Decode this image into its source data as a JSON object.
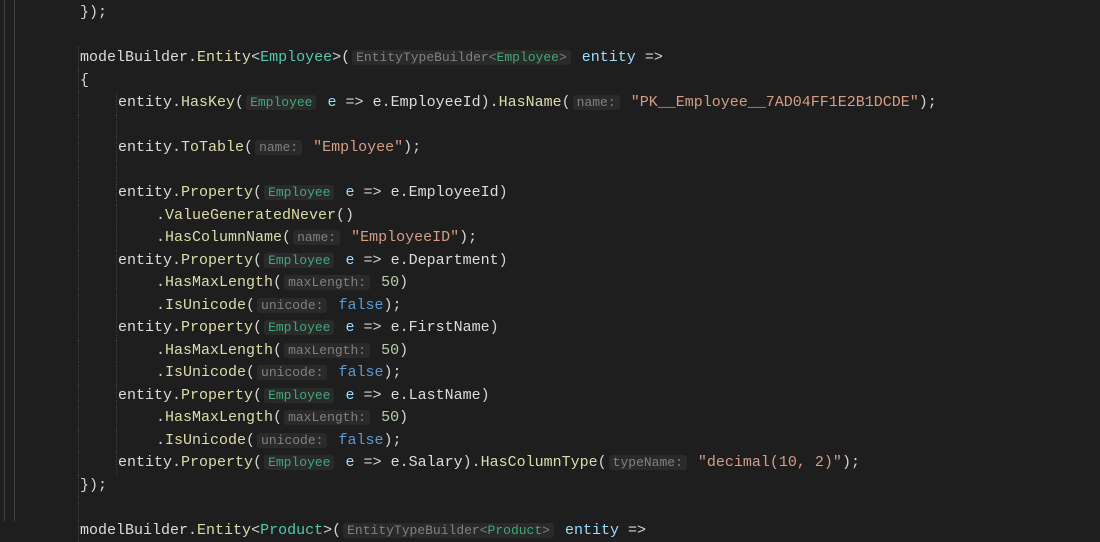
{
  "code": {
    "l0": "});",
    "l1a": "modelBuilder",
    "l1b": "Entity",
    "l1c": "Employee",
    "l1d": "EntityTypeBuilder",
    "l1e": "Employee",
    "l1f": "entity",
    "l2": "{",
    "l3a": "entity",
    "l3b": "HasKey",
    "l3c": "Employee",
    "l3d": "e",
    "l3e": "e",
    "l3f": "EmployeeId",
    "l3g": "HasName",
    "l3h": "name:",
    "l3i": "\"PK__Employee__7AD04FF1E2B1DCDE\"",
    "l5a": "entity",
    "l5b": "ToTable",
    "l5c": "name:",
    "l5d": "\"Employee\"",
    "l7a": "entity",
    "l7b": "Property",
    "l7c": "Employee",
    "l7d": "e",
    "l7e": "e",
    "l7f": "EmployeeId",
    "l8a": "ValueGeneratedNever",
    "l9a": "HasColumnName",
    "l9b": "name:",
    "l9c": "\"EmployeeID\"",
    "l10a": "entity",
    "l10b": "Property",
    "l10c": "Employee",
    "l10d": "e",
    "l10e": "e",
    "l10f": "Department",
    "l11a": "HasMaxLength",
    "l11b": "maxLength:",
    "l11c": "50",
    "l12a": "IsUnicode",
    "l12b": "unicode:",
    "l12c": "false",
    "l13a": "entity",
    "l13b": "Property",
    "l13c": "Employee",
    "l13d": "e",
    "l13e": "e",
    "l13f": "FirstName",
    "l14a": "HasMaxLength",
    "l14b": "maxLength:",
    "l14c": "50",
    "l15a": "IsUnicode",
    "l15b": "unicode:",
    "l15c": "false",
    "l16a": "entity",
    "l16b": "Property",
    "l16c": "Employee",
    "l16d": "e",
    "l16e": "e",
    "l16f": "LastName",
    "l17a": "HasMaxLength",
    "l17b": "maxLength:",
    "l17c": "50",
    "l18a": "IsUnicode",
    "l18b": "unicode:",
    "l18c": "false",
    "l19a": "entity",
    "l19b": "Property",
    "l19c": "Employee",
    "l19d": "e",
    "l19e": "e",
    "l19f": "Salary",
    "l19g": "HasColumnType",
    "l19h": "typeName:",
    "l19i": "\"decimal(10, 2)\"",
    "l20": "});",
    "l22a": "modelBuilder",
    "l22b": "Entity",
    "l22c": "Product",
    "l22d": "EntityTypeBuilder",
    "l22e": "Product",
    "l22f": "entity"
  }
}
